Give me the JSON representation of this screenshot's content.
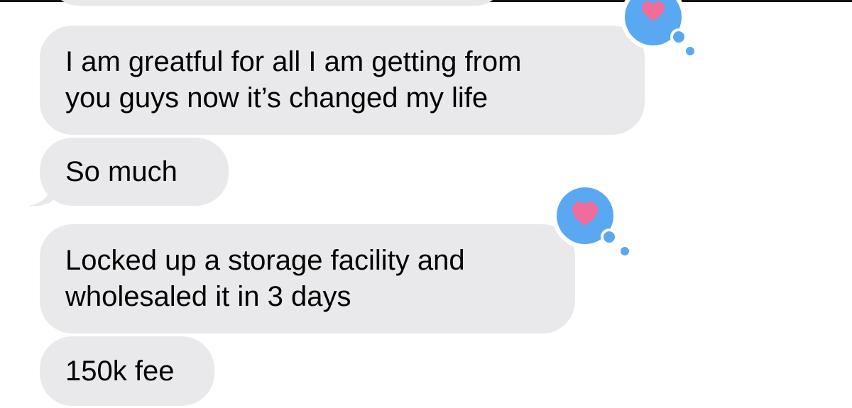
{
  "messages": [
    {
      "lines": [
        "I am greatful for all I am getting from",
        "you guys now it’s changed my life"
      ],
      "reaction": "heart-icon"
    },
    {
      "lines": [
        "So much"
      ]
    },
    {
      "lines": [
        "Locked up a storage facility and",
        "wholesaled it in 3 days"
      ],
      "reaction": "heart-icon"
    },
    {
      "lines": [
        "150k fee"
      ]
    }
  ],
  "colors": {
    "received_bubble": "#e9e9eb",
    "tapback_bubble": "#5aa7f2",
    "heart": "#ef6c9b",
    "text": "#000000"
  }
}
